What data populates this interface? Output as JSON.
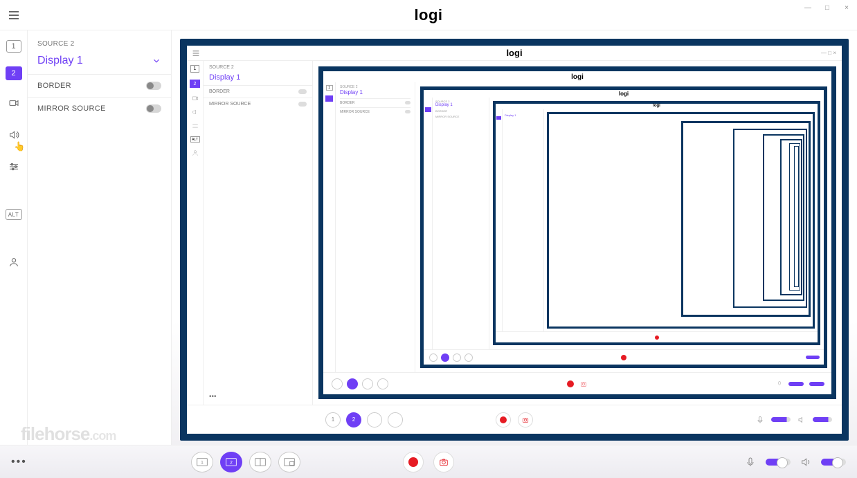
{
  "app": {
    "logo": "logi"
  },
  "window": {
    "minimize": "—",
    "maximize": "□",
    "close": "×"
  },
  "rail": {
    "scene1": "1",
    "scene2": "2",
    "alt": "ALT"
  },
  "panel": {
    "header": "SOURCE 2",
    "source_name": "Display 1",
    "opt_border": "BORDER",
    "opt_mirror": "MIRROR SOURCE"
  },
  "bottombar": {
    "more": "•••",
    "scene1": "1",
    "scene2": "2"
  },
  "watermark": {
    "main": "filehorse",
    "ext": ".com"
  }
}
